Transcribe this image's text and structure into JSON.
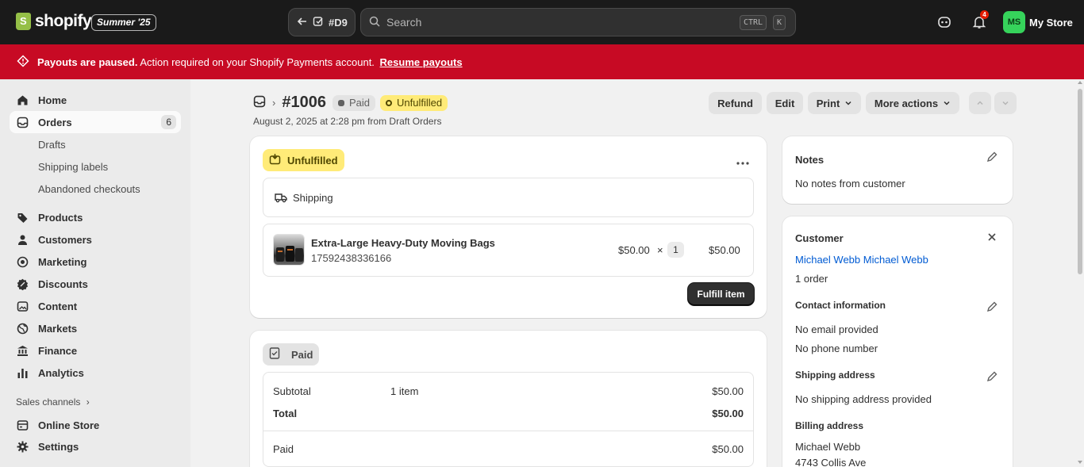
{
  "topbar": {
    "logo_text": "shopify",
    "edition_badge": "Summer '25",
    "draft_label": "#D9",
    "search_placeholder": "Search",
    "kbd_ctrl": "CTRL",
    "kbd_k": "K",
    "notifications_count": "4",
    "store_initials": "MS",
    "store_name": "My Store"
  },
  "banner": {
    "bold": "Payouts are paused.",
    "text": "Action required on your Shopify Payments account.",
    "link": "Resume payouts"
  },
  "sidebar": {
    "home": "Home",
    "orders": "Orders",
    "orders_count": "6",
    "drafts": "Drafts",
    "shipping_labels": "Shipping labels",
    "abandoned": "Abandoned checkouts",
    "products": "Products",
    "customers": "Customers",
    "marketing": "Marketing",
    "discounts": "Discounts",
    "content": "Content",
    "markets": "Markets",
    "finance": "Finance",
    "analytics": "Analytics",
    "sales_channels": "Sales channels",
    "online_store": "Online Store",
    "settings": "Settings"
  },
  "order": {
    "number": "#1006",
    "payment_status": "Paid",
    "fulfillment_status": "Unfulfilled",
    "subtitle": "August 2, 2025 at 2:28 pm from Draft Orders",
    "actions": {
      "refund": "Refund",
      "edit": "Edit",
      "print": "Print",
      "more": "More actions"
    }
  },
  "fulfillment_card": {
    "status": "Unfulfilled",
    "method": "Shipping",
    "item_name": "Extra-Large Heavy-Duty Moving Bags",
    "item_sku": "17592438336166",
    "unit_price": "$50.00",
    "times": "×",
    "qty": "1",
    "line_total": "$50.00",
    "fulfill_button": "Fulfill item"
  },
  "payment_card": {
    "status": "Paid",
    "subtotal_label": "Subtotal",
    "subtotal_items": "1 item",
    "subtotal_amount": "$50.00",
    "total_label": "Total",
    "total_amount": "$50.00",
    "paid_label": "Paid",
    "paid_amount": "$50.00"
  },
  "notes_card": {
    "title": "Notes",
    "text": "No notes from customer"
  },
  "customer_card": {
    "title": "Customer",
    "name": "Michael Webb Michael Webb",
    "orders": "1 order",
    "contact_title": "Contact information",
    "email": "No email provided",
    "phone": "No phone number",
    "shipping_title": "Shipping address",
    "shipping_text": "No shipping address provided",
    "billing_title": "Billing address",
    "billing_name": "Michael Webb",
    "billing_street": "4743 Collis Ave"
  },
  "colors": {
    "banner": "#c70a24",
    "unfulfilled": "#ffeb78",
    "link": "#005bd3",
    "avatar": "#36d35b"
  }
}
